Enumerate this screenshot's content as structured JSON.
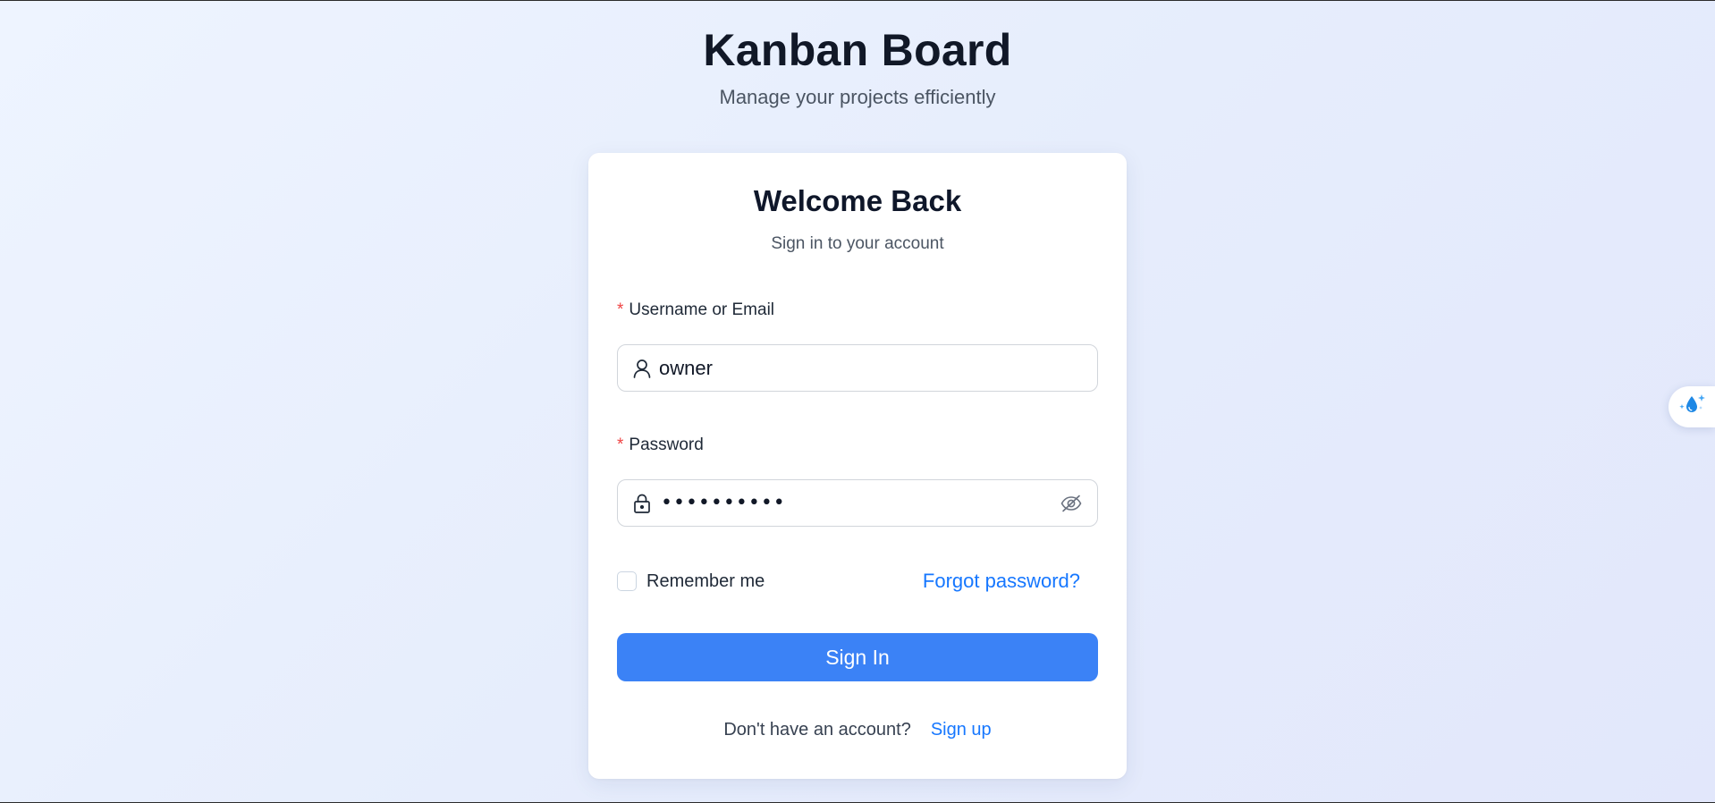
{
  "header": {
    "title": "Kanban Board",
    "subtitle": "Manage your projects efficiently"
  },
  "login_card": {
    "title": "Welcome Back",
    "subtitle": "Sign in to your account",
    "username_field": {
      "required_marker": "*",
      "label": "Username or Email",
      "value": "owner",
      "icon": "user-icon"
    },
    "password_field": {
      "required_marker": "*",
      "label": "Password",
      "masked_value": "••••••••••",
      "icon": "lock-icon",
      "toggle_icon": "eye-invisible-icon"
    },
    "remember_me": {
      "label": "Remember me",
      "checked": false
    },
    "forgot_password_label": "Forgot password?",
    "sign_in_label": "Sign In",
    "no_account_text": "Don't have an account?",
    "sign_up_label": "Sign up"
  },
  "floating_widget": {
    "icon": "sparkle-droplet-icon"
  },
  "colors": {
    "primary": "#3b82f6",
    "link": "#1677ff",
    "required": "#ef4444"
  }
}
